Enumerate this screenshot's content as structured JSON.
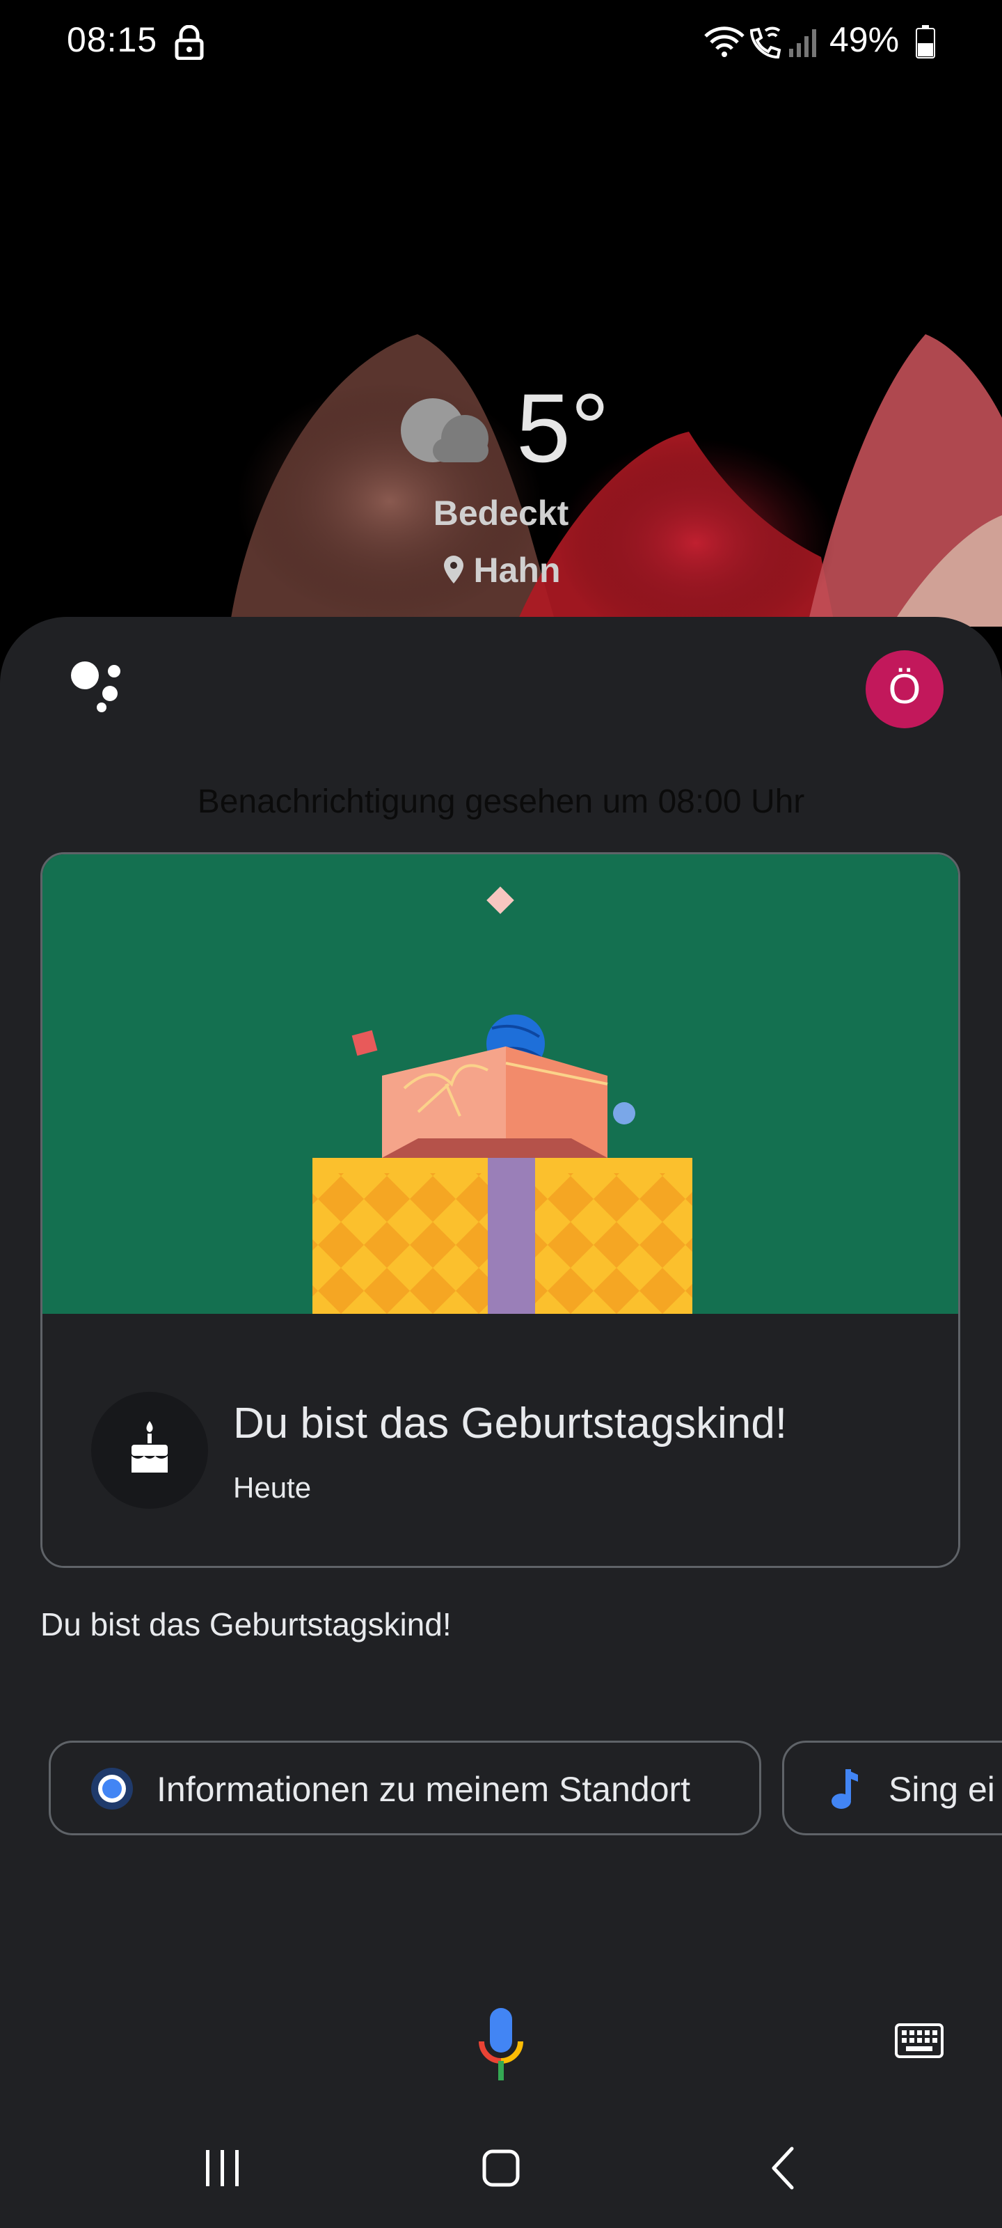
{
  "status_bar": {
    "time": "08:15",
    "battery_percent": "49%",
    "battery_level": 0.49,
    "icons": [
      "lock-icon",
      "wifi-icon",
      "wifi-call-icon",
      "signal-icon",
      "battery-icon"
    ]
  },
  "weather": {
    "temperature": "5°",
    "condition": "Bedeckt",
    "location": "Hahn",
    "icons": [
      "cloud-icon",
      "location-pin-icon"
    ]
  },
  "assistant": {
    "avatar_initial": "Ö",
    "avatar_color": "#c2185b",
    "seen_notice": "Benachrichtigung gesehen um 08:00 Uhr",
    "card": {
      "title": "Du bist das Geburtstagskind!",
      "subtitle": "Heute",
      "icon": "cake-icon",
      "illustration_background": "#147050"
    },
    "response_text": "Du bist das Geburtstagskind!",
    "suggestions": [
      {
        "label": "Informationen zu meinem Standort",
        "icon": "location-dot-icon"
      },
      {
        "label": "Sing ei",
        "icon": "music-note-icon"
      }
    ]
  },
  "input": {
    "mic_icon": "microphone-icon",
    "keyboard_icon": "keyboard-icon"
  },
  "navigation": [
    "recents-icon",
    "home-icon",
    "back-icon"
  ]
}
